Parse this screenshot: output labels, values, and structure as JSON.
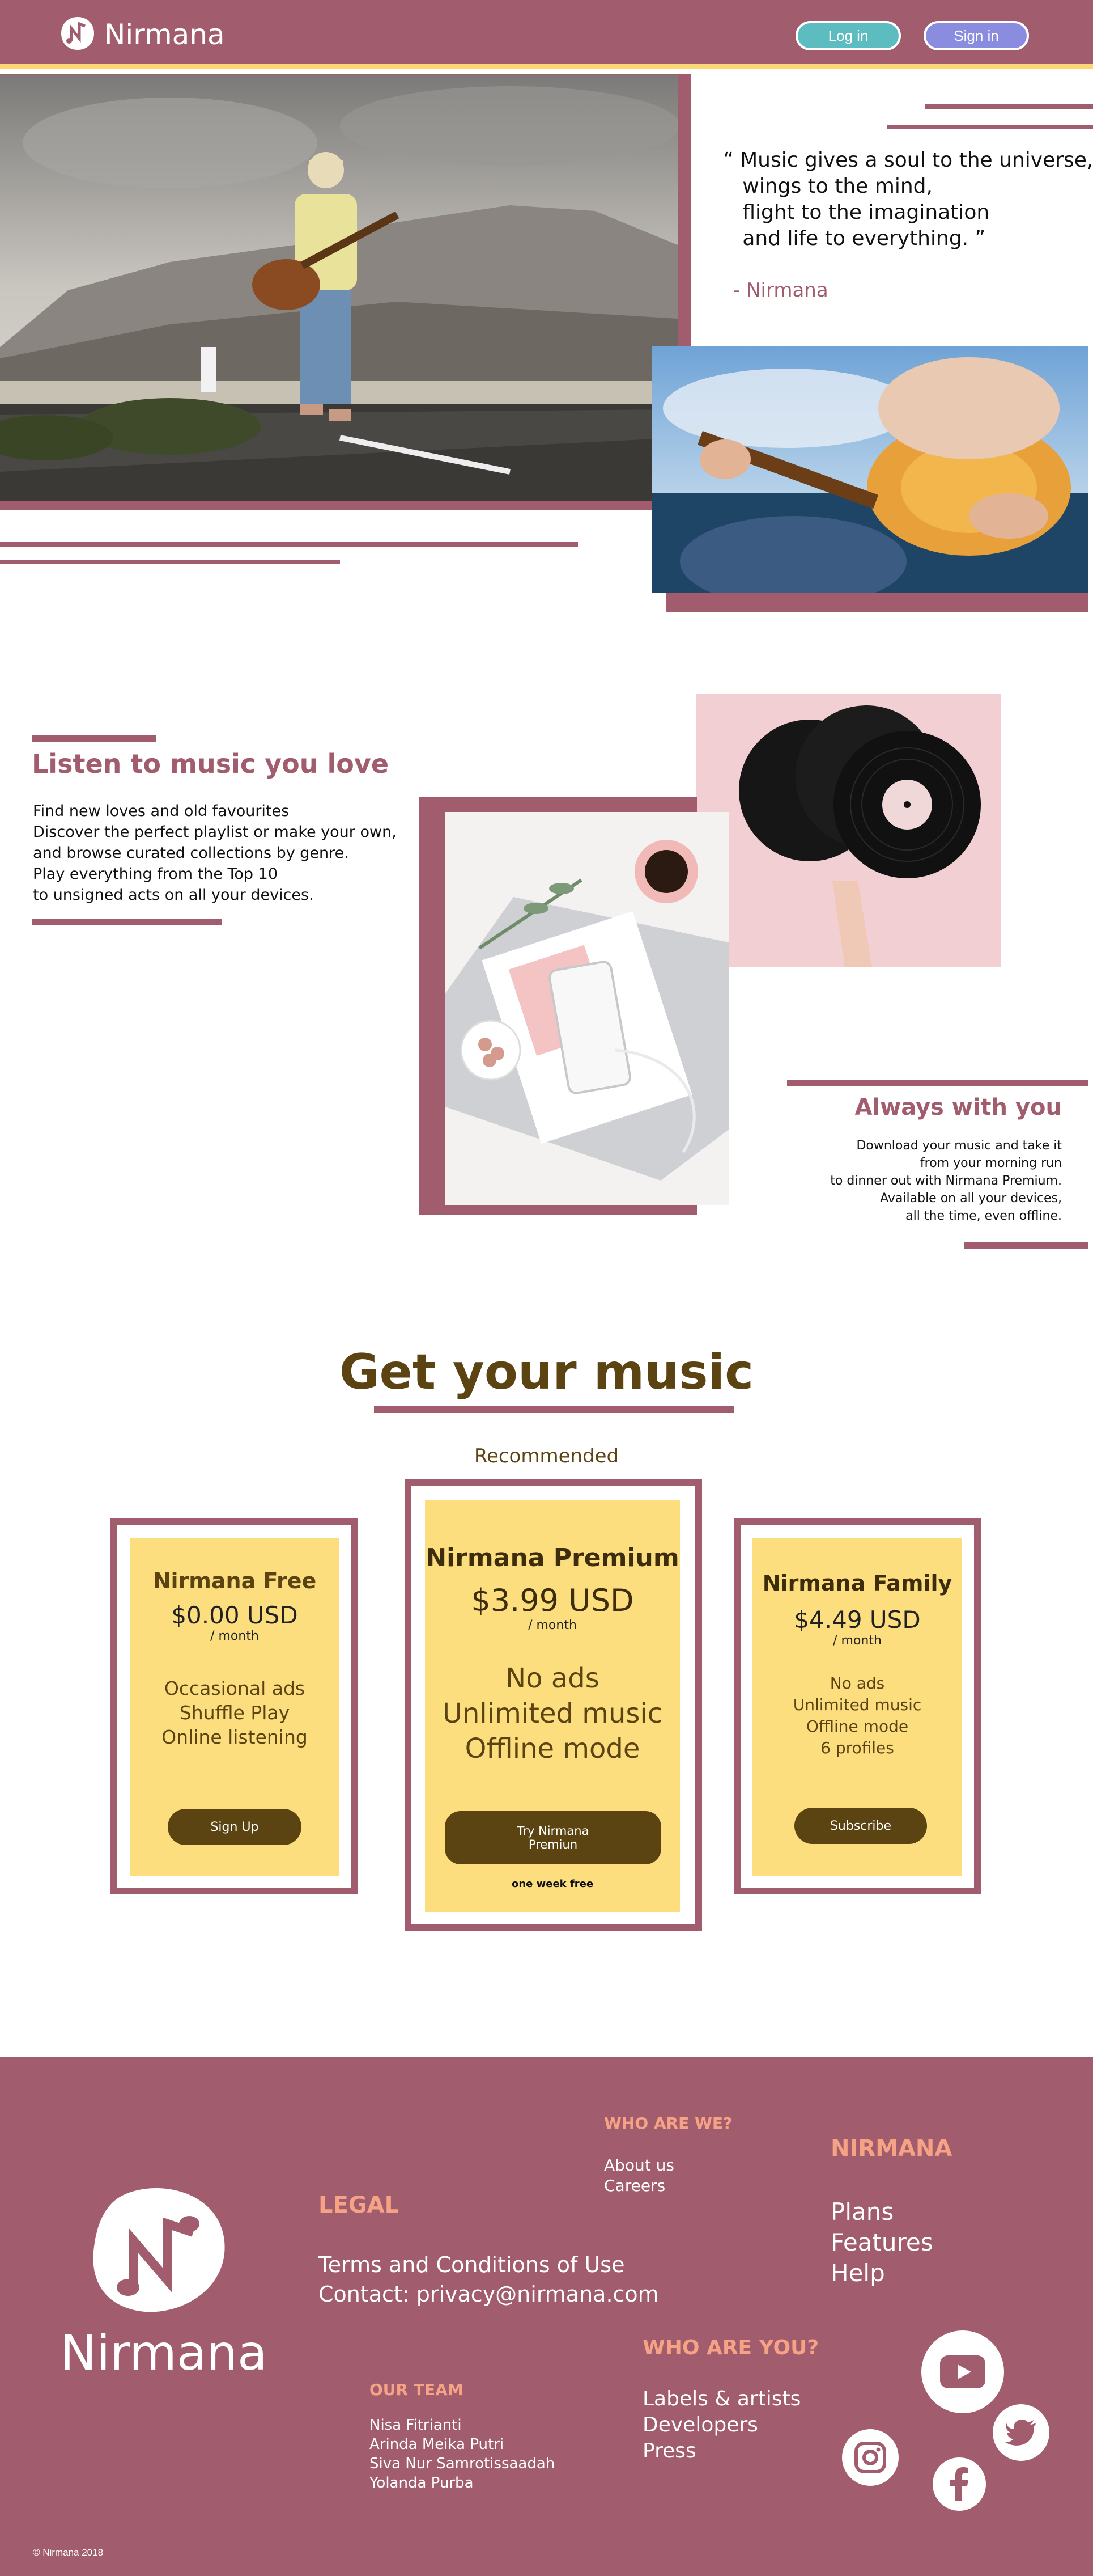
{
  "header": {
    "brand": "Nirmana",
    "login_label": "Log in",
    "signin_label": "Sign in"
  },
  "hero": {
    "quote_lines": [
      "“ Music gives a soul to the universe,",
      "   wings to the mind,",
      "   flight to the imagination",
      "   and life to everything. ”"
    ],
    "quote_author": "- Nirmana"
  },
  "listen": {
    "heading": "Listen to music you love",
    "lines": [
      "Find new loves and old favourites",
      "Discover the perfect playlist or make your own,",
      "and browse curated collections by genre.",
      "Play everything from the Top 10",
      "to unsigned acts on all your devices."
    ]
  },
  "always": {
    "heading": "Always with you",
    "lines": [
      "Download your music and take it",
      "from your morning run",
      "to dinner out with Nirmana Premium.",
      "Available on all your devices,",
      "all the time, even offline."
    ]
  },
  "pricing": {
    "title": "Get your music",
    "recommended": "Recommended",
    "plans": [
      {
        "name": "Nirmana Free",
        "price": "$0.00 USD",
        "period": "/ month",
        "features": [
          "Occasional ads",
          "Shuffle Play",
          "Online listening"
        ],
        "button": "Sign Up"
      },
      {
        "name": "Nirmana Premium",
        "price": "$3.99 USD",
        "period": "/ month",
        "features": [
          "No ads",
          "Unlimited music",
          "Offline mode"
        ],
        "button_line1": "Try Nirmana",
        "button_line2": "Premiun",
        "note": "one week free"
      },
      {
        "name": "Nirmana Family",
        "price": "$4.49 USD",
        "period": "/ month",
        "features": [
          "No ads",
          "Unlimited music",
          "Offline mode",
          "6 profiles"
        ],
        "button": "Subscribe"
      }
    ]
  },
  "footer": {
    "brand": "Nirmana",
    "legal": {
      "heading": "LEGAL",
      "terms": "Terms and Conditions of Use",
      "contact": "Contact: privacy@nirmana.com"
    },
    "who_we": {
      "heading": "WHO ARE WE?",
      "links": [
        "About us",
        "Careers"
      ]
    },
    "nirmana": {
      "heading": "NIRMANA",
      "links": [
        "Plans",
        "Features",
        "Help"
      ]
    },
    "team": {
      "heading": "OUR TEAM",
      "members": [
        "Nisa Fitrianti",
        "Arinda Meika Putri",
        "Siva Nur Samrotissaadah",
        "Yolanda Purba"
      ]
    },
    "who_you": {
      "heading": "WHO ARE YOU?",
      "links": [
        "Labels & artists",
        "Developers",
        "Press"
      ]
    },
    "social_icons": [
      "youtube-icon",
      "twitter-icon",
      "instagram-icon",
      "facebook-icon"
    ],
    "copyright": "© Nirmana 2018"
  },
  "colors": {
    "brand": "#a15d6e",
    "accent_yellow": "#fbd875",
    "card_yellow": "#fcde7e",
    "dark_brown": "#5b4412",
    "login_teal": "#5cbcc0",
    "signin_blue": "#8a8ce0",
    "footer_heading": "#f5a285"
  }
}
